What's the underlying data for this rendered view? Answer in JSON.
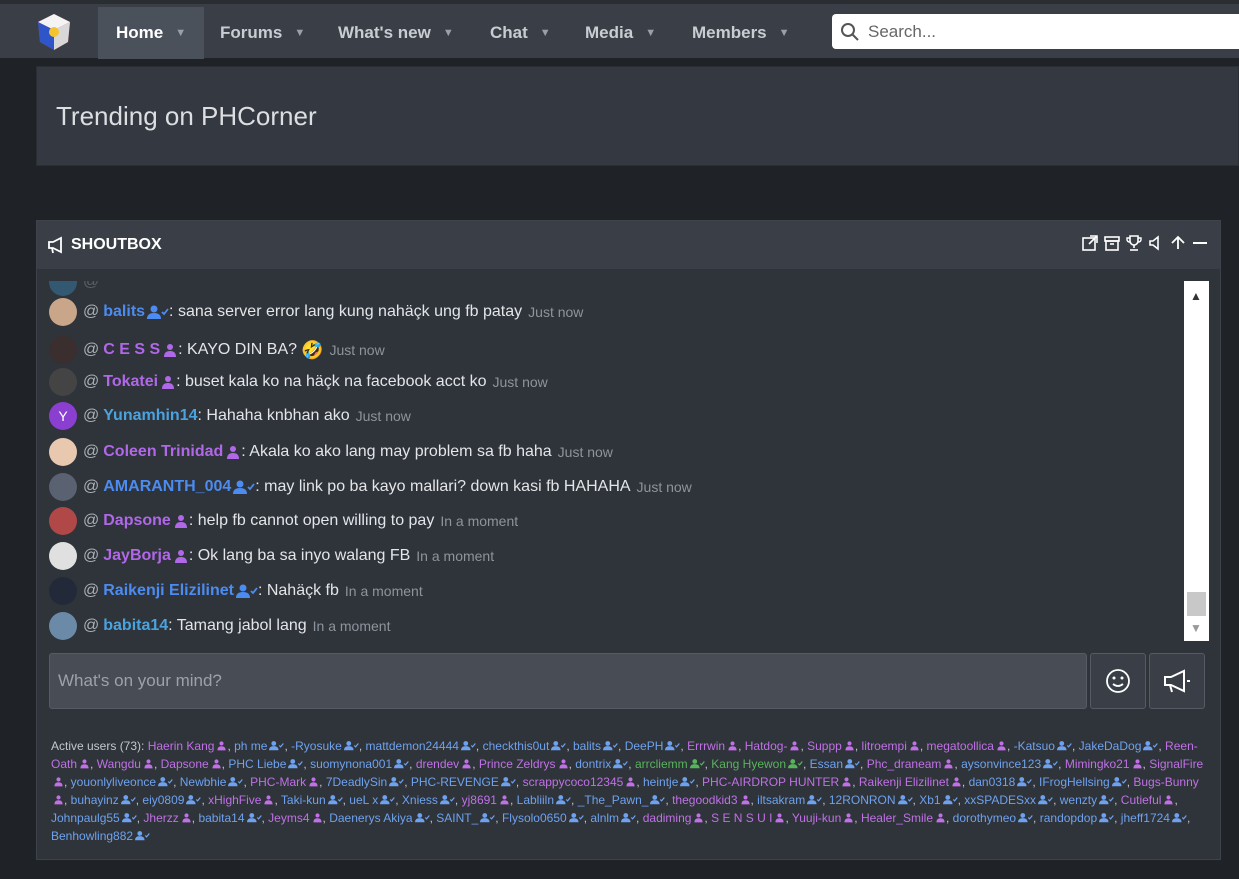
{
  "nav": {
    "items": [
      {
        "label": "Home",
        "active": true
      },
      {
        "label": "Forums"
      },
      {
        "label": "What's new"
      },
      {
        "label": "Chat"
      },
      {
        "label": "Media"
      },
      {
        "label": "Members"
      }
    ],
    "search_placeholder": "Search..."
  },
  "trending": {
    "title": "Trending on PHCorner"
  },
  "shoutbox": {
    "title": "SHOUTBOX",
    "messages": [
      {
        "user": "balits",
        "color": "blue",
        "badge": "user-check",
        "text": ": sana server error lang kung nahäçk ung fb patay",
        "time": "Just now",
        "avatar_color": "#c9a58a"
      },
      {
        "user": "C E S S",
        "color": "purple",
        "badge": "group",
        "text": ": KAYO DIN BA?",
        "emoji": "🤣",
        "time": "Just now",
        "avatar_color": "#3a2e2e"
      },
      {
        "user": "Tokatei",
        "color": "purple",
        "badge": "group",
        "text": ": buset kala ko na häçk na facebook acct ko",
        "time": "Just now",
        "avatar_color": "#444"
      },
      {
        "user": "Yunamhin14",
        "color": "teal",
        "badge": "",
        "text": ": Hahaha knbhan ako",
        "time": "Just now",
        "avatar_color": "#8b3fd1",
        "avatar_letter": "Y"
      },
      {
        "user": "Coleen Trinidad",
        "color": "purple",
        "badge": "group",
        "text": ": Akala ko ako lang may problem sa fb haha",
        "time": "Just now",
        "avatar_color": "#e8c9b0"
      },
      {
        "user": "AMARANTH_004",
        "color": "blue",
        "badge": "user-check",
        "text": ": may link po ba kayo mallari? down kasi fb HAHAHA",
        "time": "Just now",
        "avatar_color": "#5a6170"
      },
      {
        "user": "Dapsone",
        "color": "purple",
        "badge": "group",
        "text": ": help fb cannot open willing to pay",
        "time": "In a moment",
        "avatar_color": "#b04848"
      },
      {
        "user": "JayBorja",
        "color": "purple",
        "badge": "group",
        "text": ": Ok lang ba sa inyo walang FB",
        "time": "In a moment",
        "avatar_color": "#e0e0e0"
      },
      {
        "user": "Raikenji Elizilinet",
        "color": "blue",
        "badge": "user-check",
        "text": ": Nahäçk fb",
        "time": "In a moment",
        "avatar_color": "#222a3a"
      },
      {
        "user": "babita14",
        "color": "teal",
        "badge": "",
        "text": ": Tamang jabol lang",
        "time": "In a moment",
        "avatar_color": "#6a8aa8"
      }
    ],
    "compose_placeholder": "What's on your mind?",
    "active_users_label": "Active users (73):",
    "active_users": [
      {
        "n": "Haerin Kang",
        "c": "p"
      },
      {
        "n": "ph me",
        "c": "b"
      },
      {
        "n": "-Ryosuke",
        "c": "b"
      },
      {
        "n": "mattdemon24444",
        "c": "b"
      },
      {
        "n": "checkthis0ut",
        "c": "b"
      },
      {
        "n": "balits",
        "c": "b"
      },
      {
        "n": "DeePH",
        "c": "b"
      },
      {
        "n": "Errrwin",
        "c": "p"
      },
      {
        "n": "Hatdog-",
        "c": "p"
      },
      {
        "n": "Suppp",
        "c": "p"
      },
      {
        "n": "litroempi",
        "c": "p"
      },
      {
        "n": "megatoollica",
        "c": "p"
      },
      {
        "n": "-Katsuo",
        "c": "b"
      },
      {
        "n": "JakeDaDog",
        "c": "b"
      },
      {
        "n": "Reen-Oath",
        "c": "p"
      },
      {
        "n": "Wangdu",
        "c": "p"
      },
      {
        "n": "Dapsone",
        "c": "p"
      },
      {
        "n": "PHC Liebe",
        "c": "b"
      },
      {
        "n": "suomynona001",
        "c": "b"
      },
      {
        "n": "drendev",
        "c": "p"
      },
      {
        "n": "Prince Zeldrys",
        "c": "p"
      },
      {
        "n": "dontrix",
        "c": "b"
      },
      {
        "n": "arrcliemm",
        "c": "g"
      },
      {
        "n": "Kang Hyewon",
        "c": "g"
      },
      {
        "n": "Essan",
        "c": "b"
      },
      {
        "n": "Phc_draneam",
        "c": "p"
      },
      {
        "n": "aysonvince123",
        "c": "b"
      },
      {
        "n": "Mimingko21",
        "c": "p"
      },
      {
        "n": "SignalFire",
        "c": "p"
      },
      {
        "n": "youonlyliveonce",
        "c": "b"
      },
      {
        "n": "Newbhie",
        "c": "b"
      },
      {
        "n": "PHC-Mark",
        "c": "p"
      },
      {
        "n": "7DeadlySin",
        "c": "b"
      },
      {
        "n": "PHC-REVENGE",
        "c": "b"
      },
      {
        "n": "scrappycoco12345",
        "c": "p"
      },
      {
        "n": "heintje",
        "c": "b"
      },
      {
        "n": "PHC-AIRDROP HUNTER",
        "c": "p"
      },
      {
        "n": "Raikenji Elizilinet",
        "c": "p"
      },
      {
        "n": "dan0318",
        "c": "b"
      },
      {
        "n": "IFrogHellsing",
        "c": "b"
      },
      {
        "n": "Bugs-Bunny",
        "c": "p"
      },
      {
        "n": "buhayinz",
        "c": "b"
      },
      {
        "n": "eiy0809",
        "c": "b"
      },
      {
        "n": "xHighFive",
        "c": "p"
      },
      {
        "n": "Taki-kun",
        "c": "b"
      },
      {
        "n": "ueL x",
        "c": "b"
      },
      {
        "n": "Xniess",
        "c": "b"
      },
      {
        "n": "yj8691",
        "c": "p"
      },
      {
        "n": "Labliiln",
        "c": "b"
      },
      {
        "n": "_The_Pawn_",
        "c": "b"
      },
      {
        "n": "thegoodkid3",
        "c": "p"
      },
      {
        "n": "iltsakram",
        "c": "b"
      },
      {
        "n": "12RONRON",
        "c": "b"
      },
      {
        "n": "Xb1",
        "c": "b"
      },
      {
        "n": "xxSPADESxx",
        "c": "b"
      },
      {
        "n": "wenzty",
        "c": "b"
      },
      {
        "n": "Cutieful",
        "c": "p"
      },
      {
        "n": "Johnpaulg55",
        "c": "b"
      },
      {
        "n": "Jherzz",
        "c": "p"
      },
      {
        "n": "babita14",
        "c": "b"
      },
      {
        "n": "Jeyms4",
        "c": "p"
      },
      {
        "n": "Daenerys Akiya",
        "c": "b"
      },
      {
        "n": "SAINT_",
        "c": "b"
      },
      {
        "n": "Flysolo0650",
        "c": "b"
      },
      {
        "n": "alnlm",
        "c": "b"
      },
      {
        "n": "dadiming",
        "c": "p"
      },
      {
        "n": "S E N S U I",
        "c": "p"
      },
      {
        "n": "Yuuji-kun",
        "c": "p"
      },
      {
        "n": "Healer_Smile",
        "c": "p"
      },
      {
        "n": "dorothymeo",
        "c": "b"
      },
      {
        "n": "randopdop",
        "c": "b"
      },
      {
        "n": "jheff1724",
        "c": "b"
      },
      {
        "n": "Benhowling882",
        "c": "b"
      }
    ]
  }
}
